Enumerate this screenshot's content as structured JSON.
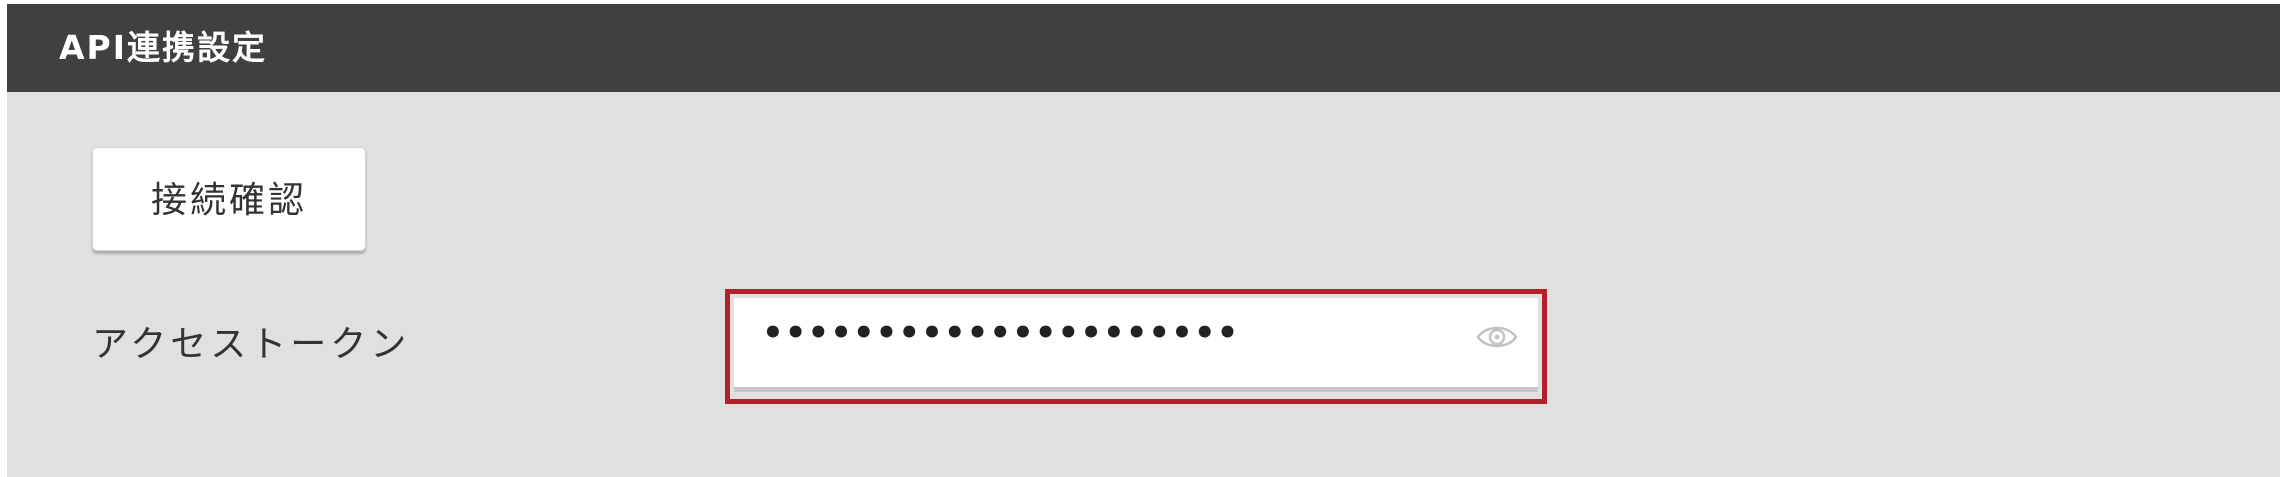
{
  "section": {
    "title": "API連携設定"
  },
  "connection_check": {
    "label": "接続確認"
  },
  "access_token": {
    "label": "アクセストークン",
    "value": "•••••••••••••••••••••",
    "visibility_icon": "eye-icon"
  },
  "colors": {
    "header_bg": "#404040",
    "panel_bg": "#e0e0e0",
    "highlight": "#b0212a"
  }
}
